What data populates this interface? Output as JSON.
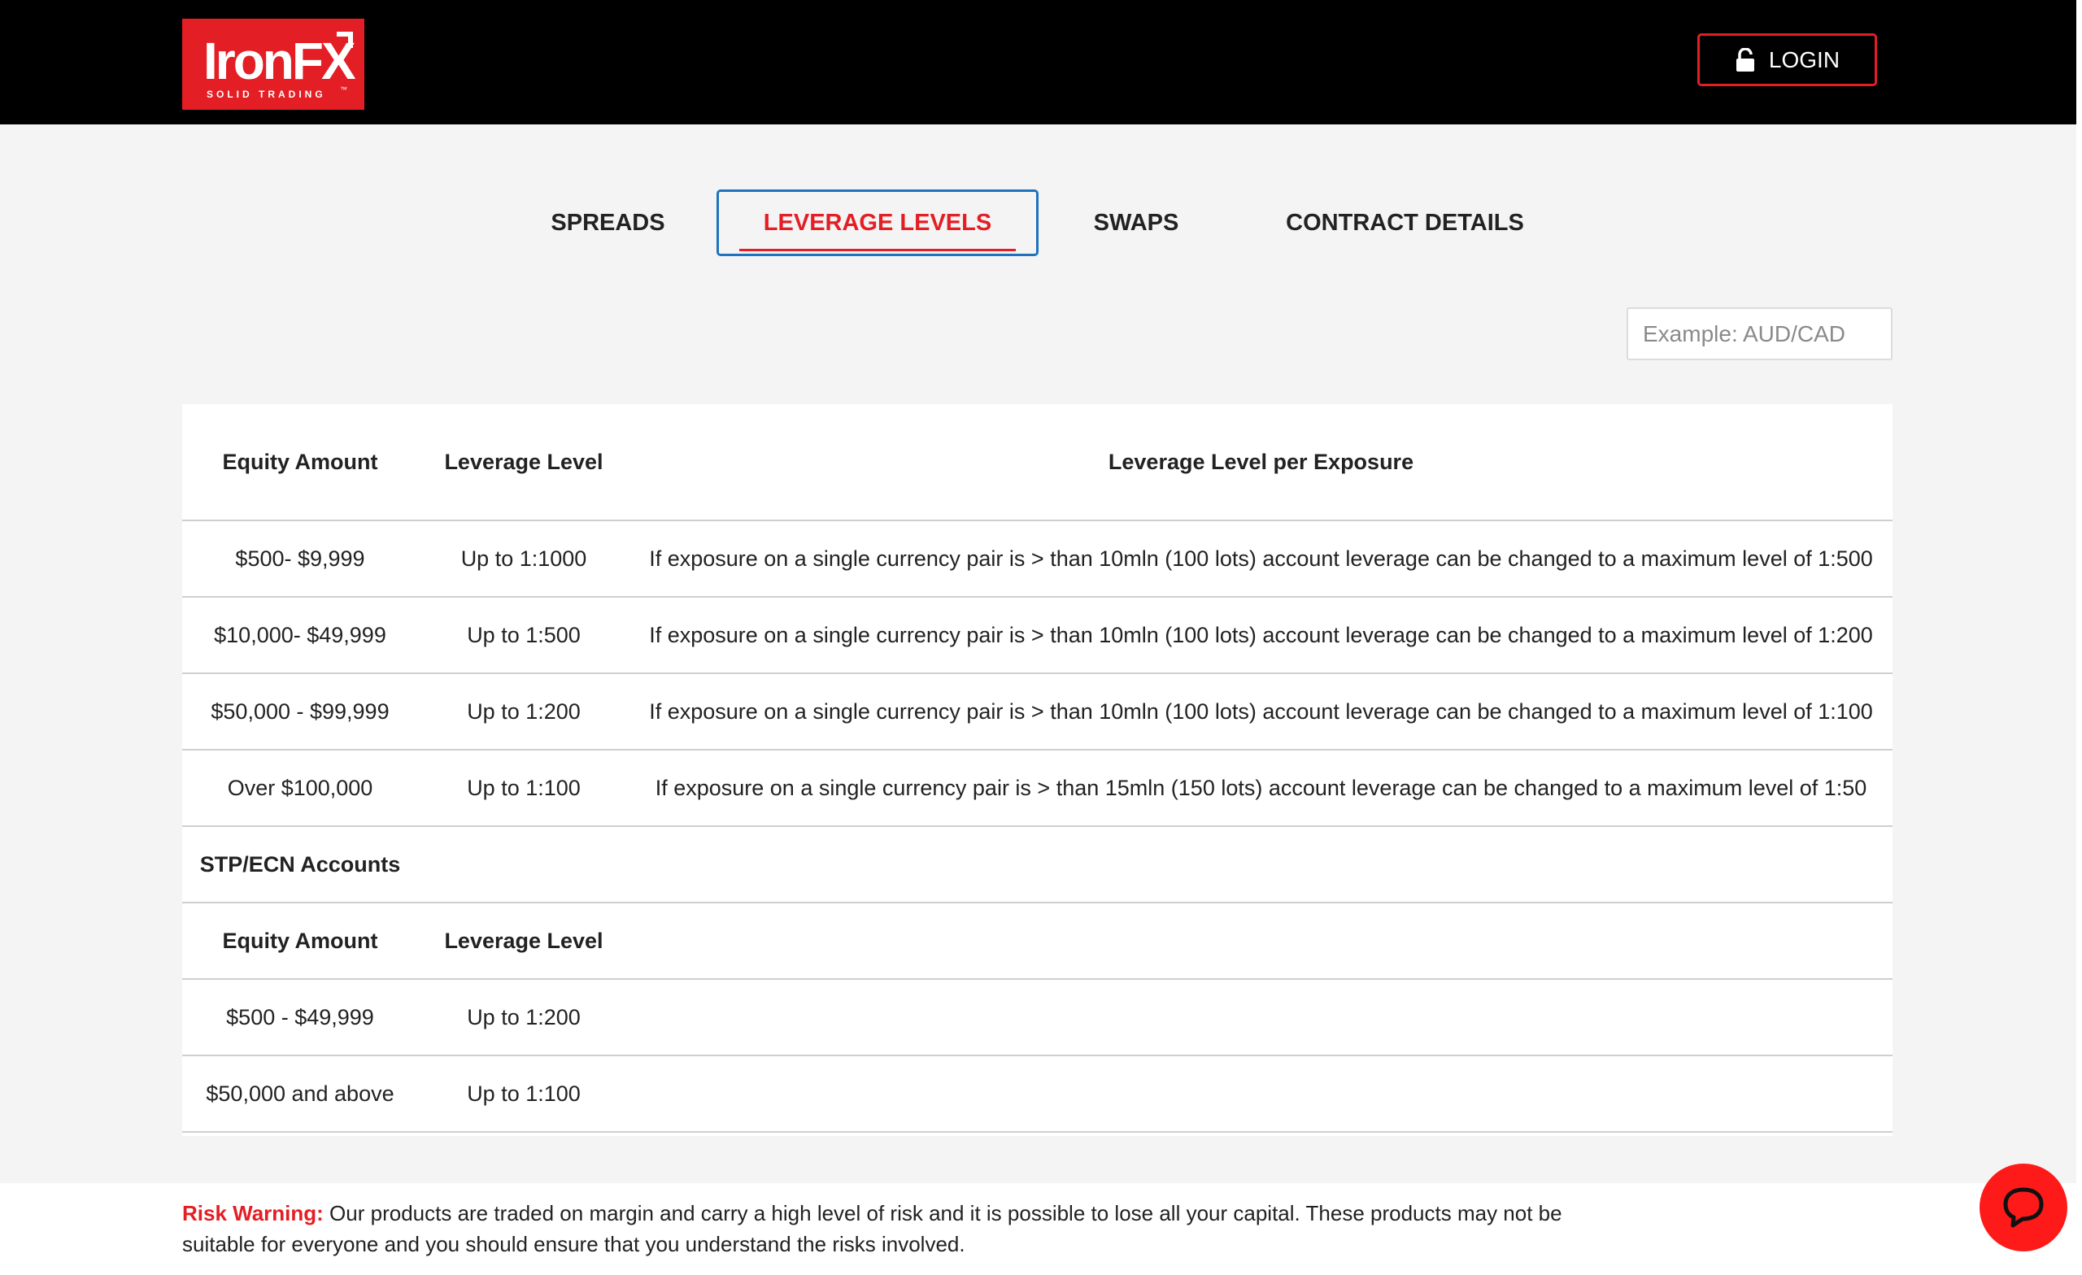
{
  "brand": {
    "name": "IronFX",
    "tagline": "SOLID TRADING",
    "tm": "™",
    "accent_color": "#e31e24"
  },
  "header": {
    "login_label": "LOGIN",
    "login_icon": "lock-open-icon"
  },
  "tabs": [
    {
      "label": "SPREADS",
      "active": false
    },
    {
      "label": "LEVERAGE LEVELS",
      "active": true
    },
    {
      "label": "SWAPS",
      "active": false
    },
    {
      "label": "CONTRACT DETAILS",
      "active": false
    }
  ],
  "search": {
    "placeholder": "Example: AUD/CAD",
    "value": ""
  },
  "leverage_table": {
    "headers": [
      "Equity Amount",
      "Leverage Level",
      "Leverage Level per Exposure"
    ],
    "rows": [
      {
        "equity": "$500- $9,999",
        "leverage": "Up to 1:1000",
        "exposure": "If exposure on a single currency pair is > than 10mln (100 lots) account leverage can be changed to a maximum level of 1:500"
      },
      {
        "equity": "$10,000- $49,999",
        "leverage": "Up to 1:500",
        "exposure": "If exposure on a single currency pair is > than 10mln (100 lots) account leverage can be changed to a maximum level of 1:200"
      },
      {
        "equity": "$50,000 - $99,999",
        "leverage": "Up to 1:200",
        "exposure": "If exposure on a single currency pair is > than 10mln (100 lots) account leverage can be changed to a maximum level of 1:100"
      },
      {
        "equity": "Over $100,000",
        "leverage": "Up to 1:100",
        "exposure": "If exposure on a single currency pair is > than 15mln (150 lots) account leverage can be changed to a maximum level of 1:50"
      }
    ]
  },
  "stp_ecn": {
    "section_title": "STP/ECN Accounts",
    "headers": [
      "Equity Amount",
      "Leverage Level"
    ],
    "rows": [
      {
        "equity": "$500 - $49,999",
        "leverage": "Up to 1:200"
      },
      {
        "equity": "$50,000 and above",
        "leverage": "Up to 1:100"
      }
    ]
  },
  "risk_warning": {
    "label": "Risk Warning:",
    "text": " Our products are traded on margin and carry a high level of risk and it is possible to lose all your capital. These products may not be suitable for everyone and you should ensure that you understand the risks involved."
  },
  "chat": {
    "icon": "chat-bubble-icon",
    "color": "#ff1a1a"
  }
}
